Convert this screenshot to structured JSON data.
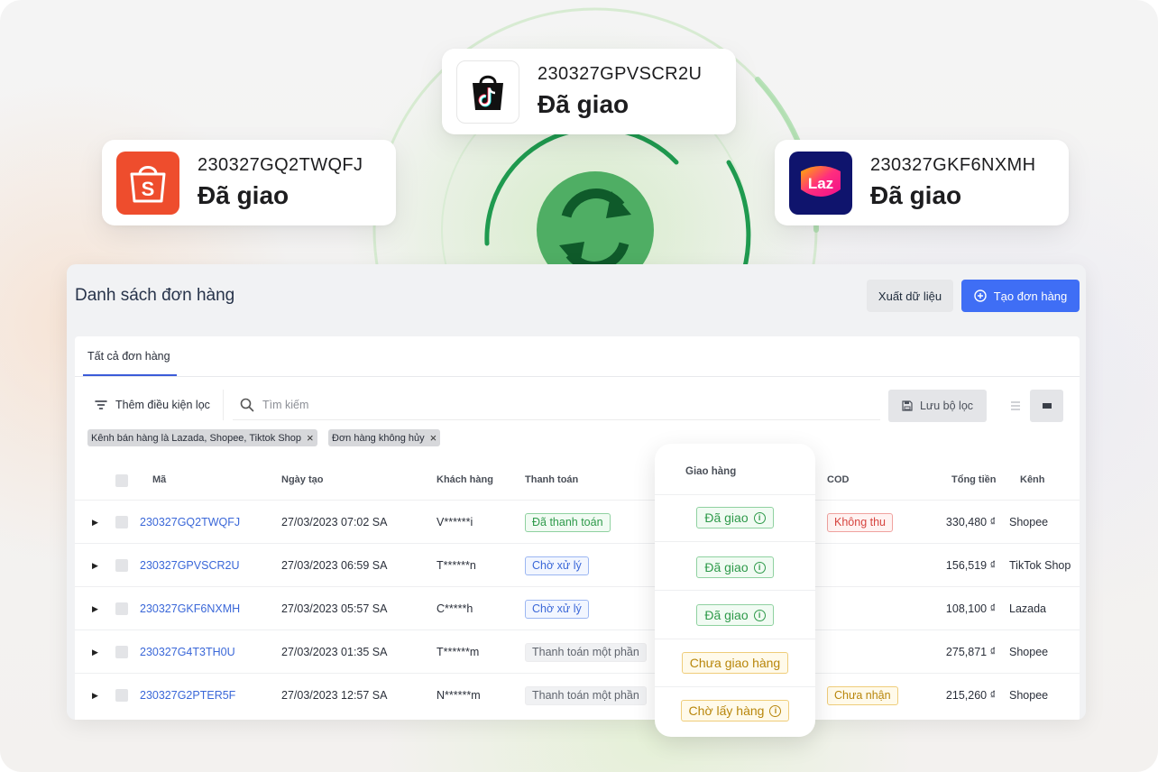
{
  "floating_orders": [
    {
      "platform_icon": "shopee-icon",
      "code": "230327GQ2TWQFJ",
      "status": "Đã giao"
    },
    {
      "platform_icon": "tiktok-shop-icon",
      "code": "230327GPVSCR2U",
      "status": "Đã giao"
    },
    {
      "platform_icon": "lazada-icon",
      "code": "230327GKF6NXMH",
      "status": "Đã giao",
      "logo_text": "Laz"
    }
  ],
  "sync_icon": "sync-arrows-icon",
  "panel": {
    "title": "Danh sách đơn hàng",
    "export_label": "Xuất dữ liệu",
    "create_label": "Tạo đơn hàng",
    "tab_all": "Tất cả đơn hàng",
    "add_filter_label": "Thêm điều kiện lọc",
    "search_placeholder": "Tìm kiếm",
    "save_filter_label": "Lưu bộ lọc",
    "chips": [
      "Kênh bán hàng là Lazada, Shopee, Tiktok Shop",
      "Đơn hàng không hủy"
    ]
  },
  "table": {
    "headers": {
      "code": "Mã",
      "created": "Ngày tạo",
      "customer": "Khách hàng",
      "payment": "Thanh toán",
      "delivery": "Giao hàng",
      "cod": "COD",
      "total": "Tổng tiền",
      "channel": "Kênh"
    },
    "rows": [
      {
        "code": "230327GQ2TWQFJ",
        "created": "27/03/2023 07:02 SA",
        "customer": "V******i",
        "payment": "Đã thanh toán",
        "delivery": "Đã giao",
        "cod": "Không thu",
        "total": "330,480 ₫",
        "channel": "Shopee"
      },
      {
        "code": "230327GPVSCR2U",
        "created": "27/03/2023 06:59 SA",
        "customer": "T******n",
        "payment": "Chờ xử lý",
        "delivery": "Đã giao",
        "cod": "",
        "total": "156,519 ₫",
        "channel": "TikTok Shop"
      },
      {
        "code": "230327GKF6NXMH",
        "created": "27/03/2023 05:57 SA",
        "customer": "C*****h",
        "payment": "Chờ xử lý",
        "delivery": "Đã giao",
        "cod": "",
        "total": "108,100 ₫",
        "channel": "Lazada"
      },
      {
        "code": "230327G4T3TH0U",
        "created": "27/03/2023 01:35 SA",
        "customer": "T******m",
        "payment": "Thanh toán một phần",
        "delivery": "Chưa giao hàng",
        "cod": "",
        "total": "275,871 ₫",
        "channel": "Shopee"
      },
      {
        "code": "230327G2PTER5F",
        "created": "27/03/2023 12:57 SA",
        "customer": "N******m",
        "payment": "Thanh toán một phần",
        "delivery": "Chờ lấy hàng",
        "cod": "Chưa nhận",
        "total": "215,260 ₫",
        "channel": "Shopee"
      }
    ]
  },
  "colors": {
    "primary": "#3f6ef5",
    "shopee": "#ee4d2d",
    "lazada": "#0f146d",
    "sync_green": "#2e9a4a"
  }
}
